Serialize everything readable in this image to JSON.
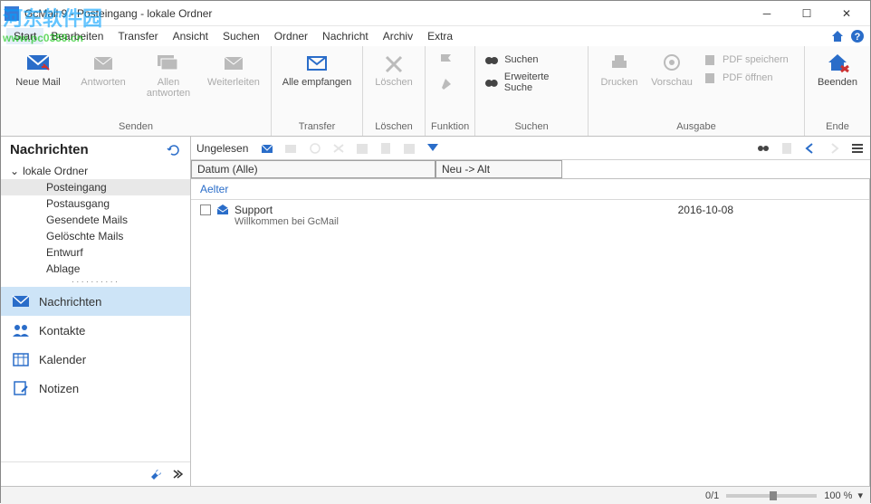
{
  "title": "GcMail 9 - Posteingang - lokale Ordner",
  "menubar": [
    "Start",
    "Bearbeiten",
    "Transfer",
    "Ansicht",
    "Suchen",
    "Ordner",
    "Nachricht",
    "Archiv",
    "Extra"
  ],
  "ribbon": {
    "senden": {
      "label": "Senden",
      "new_mail": "Neue Mail",
      "reply": "Antworten",
      "reply_all": "Allen\nantworten",
      "forward": "Weiterleiten"
    },
    "transfer": {
      "label": "Transfer",
      "receive_all": "Alle empfangen"
    },
    "delete": {
      "label": "Löschen",
      "delete": "Löschen"
    },
    "funktion": {
      "label": "Funktion"
    },
    "suchen": {
      "label": "Suchen",
      "search": "Suchen",
      "ext_search": "Erweiterte Suche"
    },
    "ausgabe": {
      "label": "Ausgabe",
      "print": "Drucken",
      "preview": "Vorschau",
      "pdf_save": "PDF speichern",
      "pdf_open": "PDF öffnen"
    },
    "ende": {
      "label": "Ende",
      "exit": "Beenden"
    }
  },
  "sidebar": {
    "header": "Nachrichten",
    "root": "lokale Ordner",
    "folders": [
      "Posteingang",
      "Postausgang",
      "Gesendete Mails",
      "Gelöschte Mails",
      "Entwurf",
      "Ablage"
    ],
    "navs": [
      {
        "key": "messages",
        "label": "Nachrichten",
        "selected": true
      },
      {
        "key": "contacts",
        "label": "Kontakte",
        "selected": false
      },
      {
        "key": "calendar",
        "label": "Kalender",
        "selected": false
      },
      {
        "key": "notes",
        "label": "Notizen",
        "selected": false
      }
    ]
  },
  "toolbar2": {
    "unread": "Ungelesen"
  },
  "columns": {
    "date": "Datum (Alle)",
    "sort": "Neu -> Alt"
  },
  "group_header": "Aelter",
  "messages": [
    {
      "from": "Support",
      "date": "2016-10-08",
      "preview": "Willkommen bei GcMail"
    }
  ],
  "status": {
    "count": "0/1",
    "zoom": "100 %"
  }
}
